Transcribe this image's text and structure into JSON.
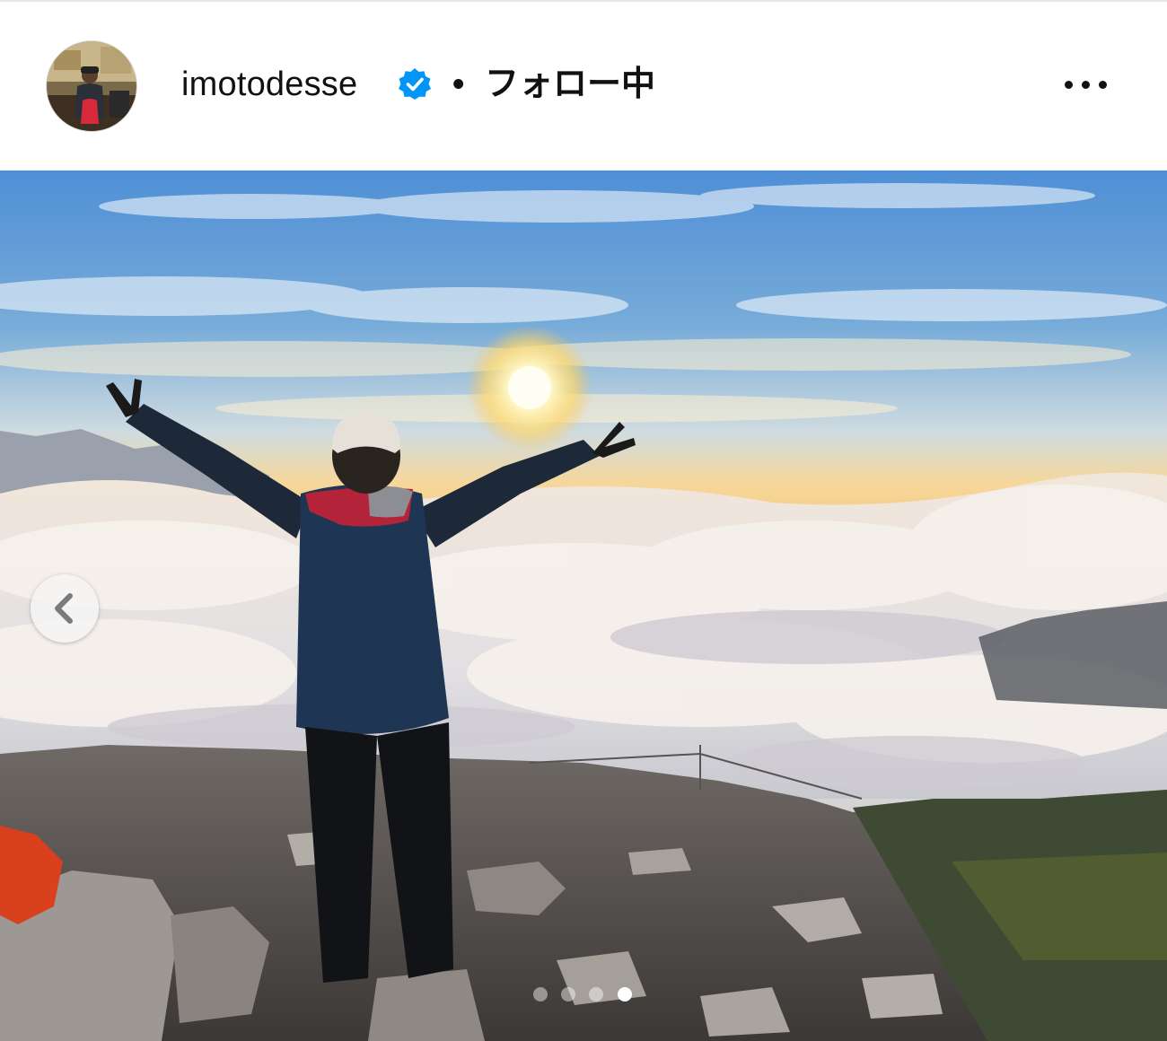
{
  "post_header": {
    "username": "imotodesse",
    "separator": "•",
    "follow_status": "フォロー中",
    "verified": true,
    "verified_color": "#0095f6",
    "more_icon": "more-horizontal-icon",
    "avatar_icon": "profile-avatar"
  },
  "carousel": {
    "prev_icon": "chevron-left-icon",
    "slide_count": 4,
    "active_index": 4,
    "image_description_icon": "mountain-sunrise-photo"
  }
}
